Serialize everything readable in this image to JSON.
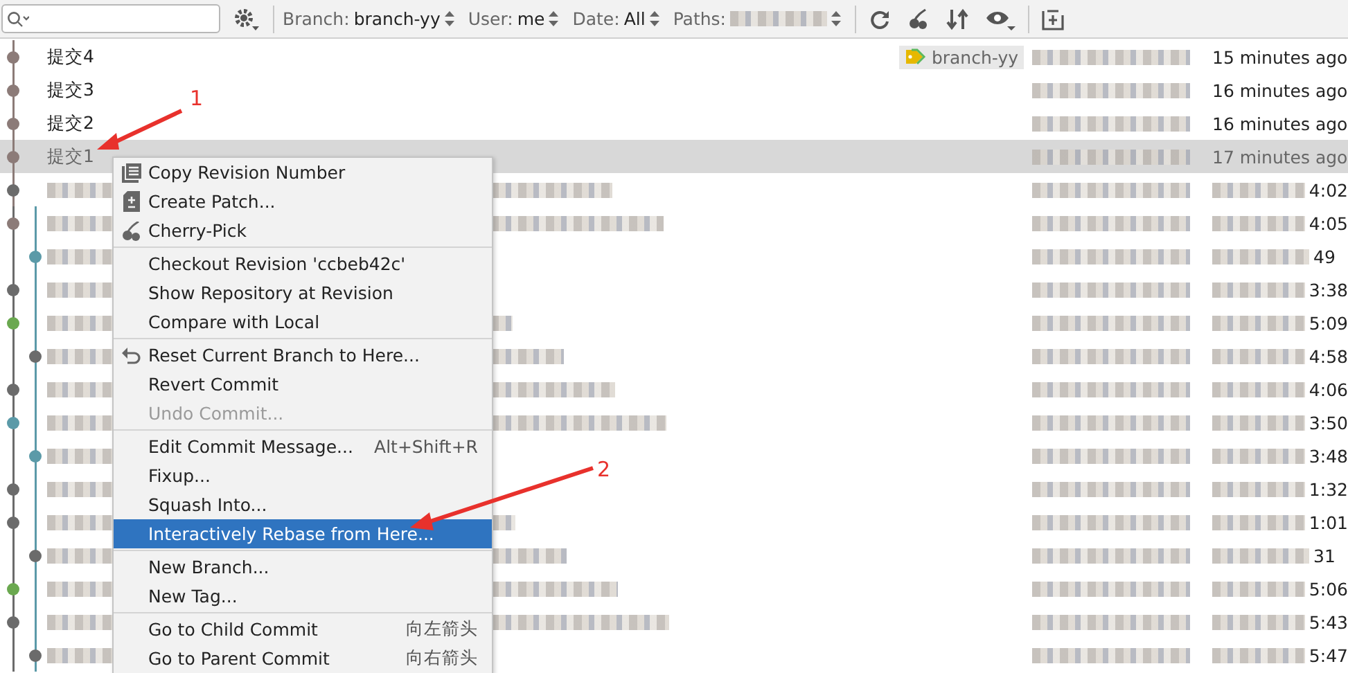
{
  "toolbar": {
    "filters": [
      {
        "label": "Branch:",
        "value": "branch-yy",
        "blurred": false
      },
      {
        "label": "User:",
        "value": "me",
        "blurred": false
      },
      {
        "label": "Date:",
        "value": "All",
        "blurred": false
      },
      {
        "label": "Paths:",
        "blurred": true
      }
    ]
  },
  "rows": [
    {
      "subject": "提交4",
      "tag": "branch-yy",
      "date": "15 minutes ago",
      "selected": false,
      "color": "#8c7b78"
    },
    {
      "subject": "提交3",
      "date": "16 minutes ago",
      "selected": false,
      "color": "#8c7b78"
    },
    {
      "subject": "提交2",
      "date": "16 minutes ago",
      "selected": false,
      "color": "#8c7b78"
    },
    {
      "subject": "提交1",
      "date": "17 minutes ago",
      "selected": true,
      "color": "#8c7b78"
    },
    {
      "date": "4:02",
      "selected": false,
      "color": "#6b6b6b"
    },
    {
      "date": "4:05",
      "selected": false,
      "color": "#8c7b78"
    },
    {
      "date": "49",
      "selected": false,
      "color": "#5b9aa8"
    },
    {
      "date": "3:38",
      "selected": false,
      "color": "#6b6b6b"
    },
    {
      "date": "5:09",
      "selected": false,
      "color": "#6aa84f"
    },
    {
      "date": "4:58",
      "selected": false,
      "color": "#6b6b6b"
    },
    {
      "date": "4:06",
      "selected": false,
      "color": "#6b6b6b"
    },
    {
      "date": "3:50",
      "selected": false,
      "color": "#5b9aa8"
    },
    {
      "date": "3:48",
      "selected": false,
      "color": "#5b9aa8"
    },
    {
      "date": "1:32",
      "selected": false,
      "color": "#6b6b6b"
    },
    {
      "date": "1:01",
      "selected": false,
      "color": "#6b6b6b"
    },
    {
      "date": "31",
      "selected": false,
      "color": "#6b6b6b"
    },
    {
      "date": "5:06",
      "selected": false,
      "color": "#6aa84f"
    },
    {
      "date": "5:43",
      "selected": false,
      "color": "#6b6b6b"
    },
    {
      "date": "5:47",
      "selected": false,
      "color": "#6b6b6b"
    }
  ],
  "context_menu": [
    {
      "kind": "copy",
      "label": "Copy Revision Number",
      "disabled": false,
      "selected": false
    },
    {
      "kind": "patch",
      "label": "Create Patch...",
      "disabled": false,
      "selected": false
    },
    {
      "kind": "cherry",
      "label": "Cherry-Pick",
      "disabled": false,
      "selected": false
    },
    {
      "kind": "separator"
    },
    {
      "kind": "plain",
      "label": "Checkout Revision 'ccbeb42c'",
      "disabled": false,
      "selected": false
    },
    {
      "kind": "plain",
      "label": "Show Repository at Revision",
      "disabled": false,
      "selected": false
    },
    {
      "kind": "plain",
      "label": "Compare with Local",
      "disabled": false,
      "selected": false
    },
    {
      "kind": "separator"
    },
    {
      "kind": "reset",
      "label": "Reset Current Branch to Here...",
      "disabled": false,
      "selected": false
    },
    {
      "kind": "plain",
      "label": "Revert Commit",
      "disabled": false,
      "selected": false
    },
    {
      "kind": "plain",
      "label": "Undo Commit...",
      "disabled": true,
      "selected": false
    },
    {
      "kind": "separator"
    },
    {
      "kind": "plain",
      "label": "Edit Commit Message...",
      "shortcut": "Alt+Shift+R",
      "disabled": false,
      "selected": false
    },
    {
      "kind": "plain",
      "label": "Fixup...",
      "disabled": false,
      "selected": false
    },
    {
      "kind": "plain",
      "label": "Squash Into...",
      "disabled": false,
      "selected": false
    },
    {
      "kind": "plain",
      "label": "Interactively Rebase from Here...",
      "disabled": false,
      "selected": true
    },
    {
      "kind": "separator"
    },
    {
      "kind": "plain",
      "label": "New Branch...",
      "disabled": false,
      "selected": false
    },
    {
      "kind": "plain",
      "label": "New Tag...",
      "disabled": false,
      "selected": false
    },
    {
      "kind": "separator"
    },
    {
      "kind": "plain",
      "label": "Go to Child Commit",
      "shortcut": "向左箭头",
      "disabled": false,
      "selected": false
    },
    {
      "kind": "plain",
      "label": "Go to Parent Commit",
      "shortcut": "向右箭头",
      "disabled": false,
      "selected": false
    }
  ],
  "annotations": [
    {
      "number": "1"
    },
    {
      "number": "2"
    }
  ]
}
